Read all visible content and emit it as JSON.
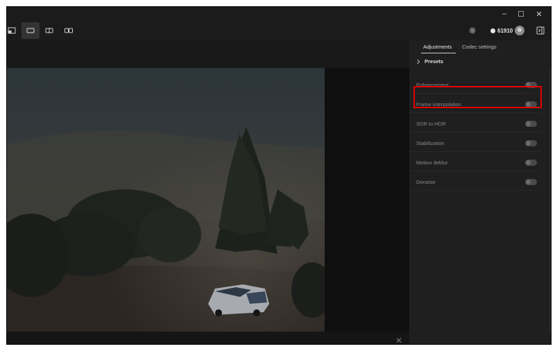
{
  "window": {
    "controls": {
      "minimize": "–",
      "maximize": "☐",
      "close": "✕"
    }
  },
  "toolbar": {
    "credits": "61910",
    "icons": [
      "crop-view-icon",
      "single-view-icon",
      "split-view-icon",
      "side-by-side-view-icon",
      "settings-gear-icon",
      "user-avatar-icon",
      "panel-toggle-icon"
    ]
  },
  "preview": {
    "close_glyph": "✕",
    "more_glyph": "···"
  },
  "panel": {
    "tabs": [
      "Adjustments",
      "Codec settings"
    ],
    "presets_label": "Presets",
    "rows": [
      {
        "label": "Enhancement",
        "enabled": false
      },
      {
        "label": "Frame interpolation",
        "enabled": false
      },
      {
        "label": "SDR to HDR",
        "enabled": false
      },
      {
        "label": "Stabilization",
        "enabled": false
      },
      {
        "label": "Motion deblur",
        "enabled": false
      },
      {
        "label": "Denoise",
        "enabled": false
      }
    ]
  },
  "colors": {
    "highlight": "#e60000",
    "window_bg": "#1b1b1b",
    "panel_bg": "#1f1f1f"
  }
}
